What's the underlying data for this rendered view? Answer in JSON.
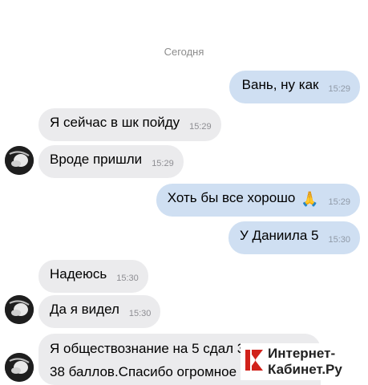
{
  "date_divider": "Сегодня",
  "messages": [
    {
      "text": "Вань, ну как",
      "time": "15:29",
      "direction": "out"
    },
    {
      "text": "Я сейчас в шк пойду",
      "time": "15:29",
      "direction": "in"
    },
    {
      "text": "Вроде пришли",
      "time": "15:29",
      "direction": "in"
    },
    {
      "text": "Хоть бы все хорошо",
      "emoji": "🙏",
      "time": "15:29",
      "direction": "out"
    },
    {
      "text": "У Даниила 5",
      "time": "15:30",
      "direction": "out"
    },
    {
      "text": "Надеюсь",
      "time": "15:30",
      "direction": "in"
    },
    {
      "text": "Да я видел",
      "time": "15:30",
      "direction": "in"
    },
    {
      "line1": "Я обществознание на 5 сдал 36 или",
      "line2": "38 баллов.Спасибо огромное",
      "direction": "in"
    }
  ],
  "watermark": {
    "line1": "Интернет-",
    "line2": "Кабинет.Ру"
  },
  "colors": {
    "outgoing_bubble": "#cfdff2",
    "incoming_bubble": "#ebebed",
    "timestamp": "#909aa7",
    "date_text": "#8c8c8c"
  }
}
